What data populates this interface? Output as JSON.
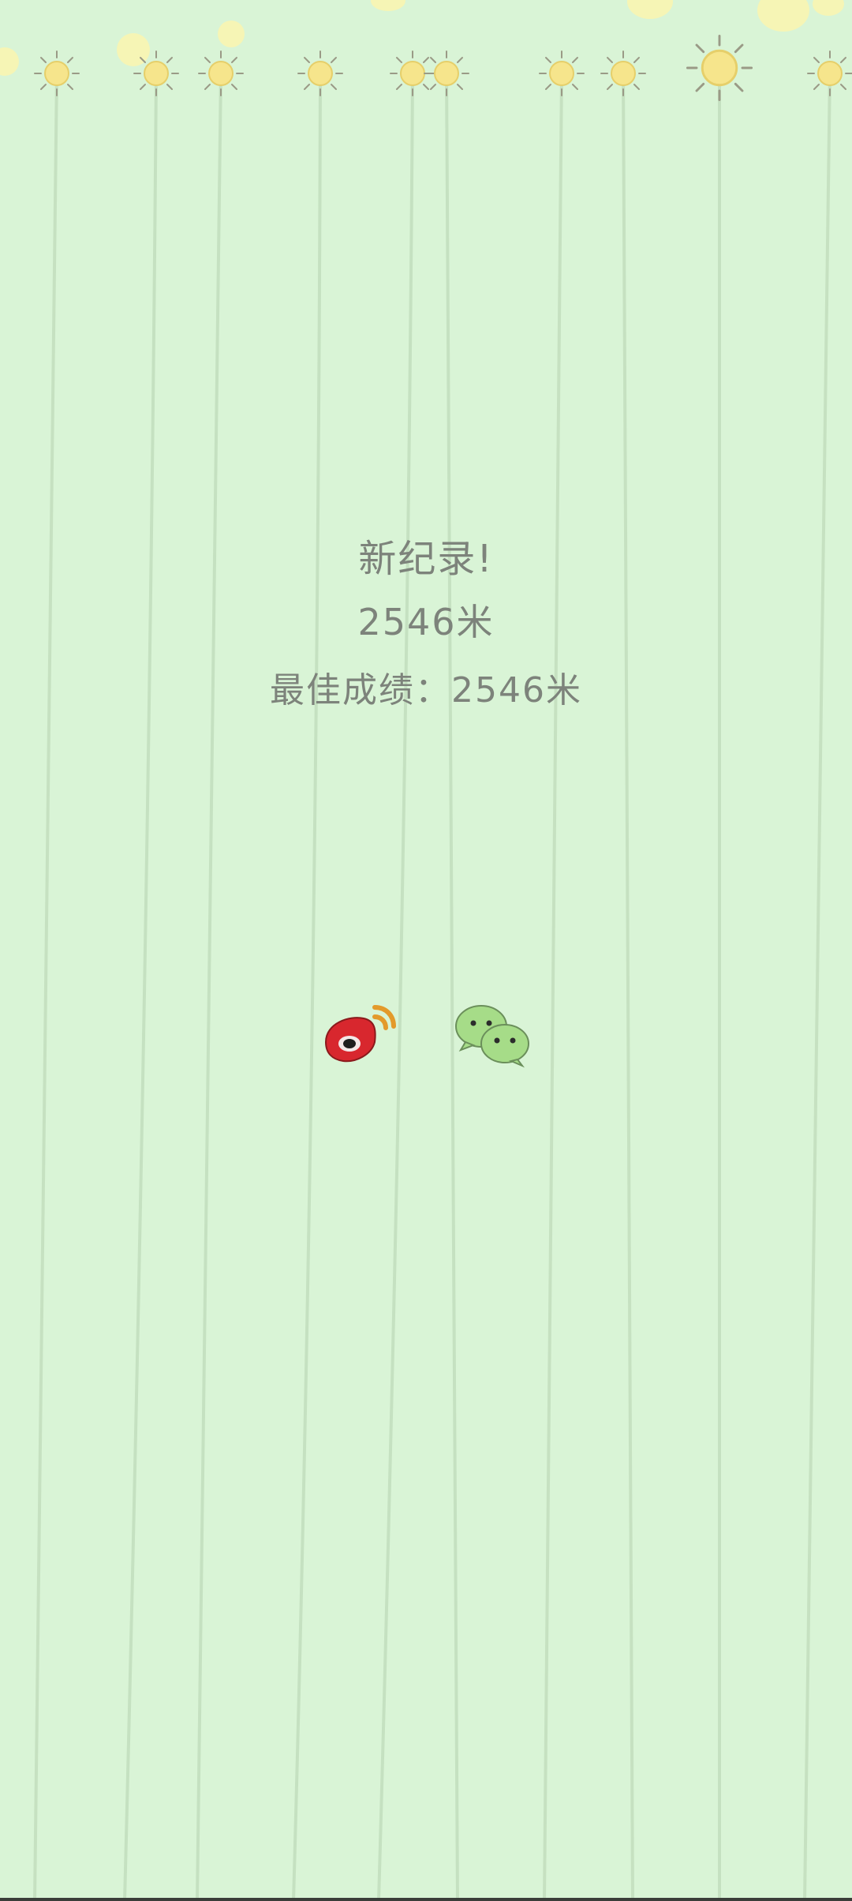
{
  "result": {
    "title": "新纪录!",
    "score": "2546米",
    "best": "最佳成绩：2546米"
  },
  "share": {
    "weibo_icon": "weibo-icon",
    "wechat_icon": "wechat-icon"
  },
  "colors": {
    "background": "#d9f4d6",
    "text": "#7d837b",
    "sun": "#f6e58c",
    "string": "#c3dfbf",
    "weibo_red": "#d8272e",
    "wechat_green": "#a6dc88"
  }
}
